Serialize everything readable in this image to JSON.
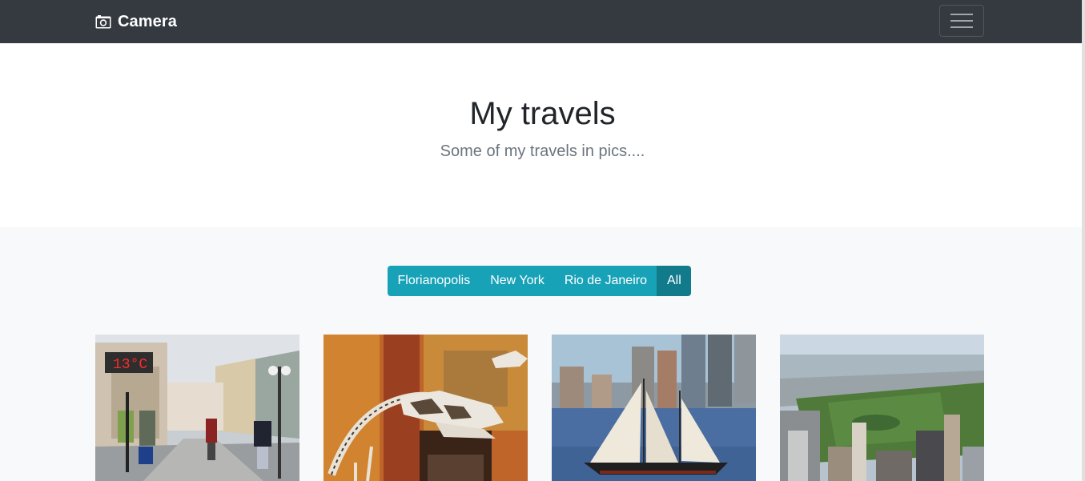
{
  "navbar": {
    "brand_text": "Camera",
    "brand_icon": "camera-icon",
    "toggler_icon": "hamburger-menu-icon"
  },
  "hero": {
    "title": "My travels",
    "subtitle": "Some of my travels in pics...."
  },
  "filters": {
    "buttons": [
      {
        "label": "Florianopolis",
        "active": false
      },
      {
        "label": "New York",
        "active": false
      },
      {
        "label": "Rio de Janeiro",
        "active": false
      },
      {
        "label": "All",
        "active": true
      }
    ]
  },
  "photos": [
    {
      "thermometer_text": "13°C"
    },
    {},
    {},
    {}
  ],
  "colors": {
    "navbar": "#343a40",
    "accent": "#17a2b8",
    "accent_active": "#117a8b",
    "gallery_bg": "#f8f9fa"
  }
}
